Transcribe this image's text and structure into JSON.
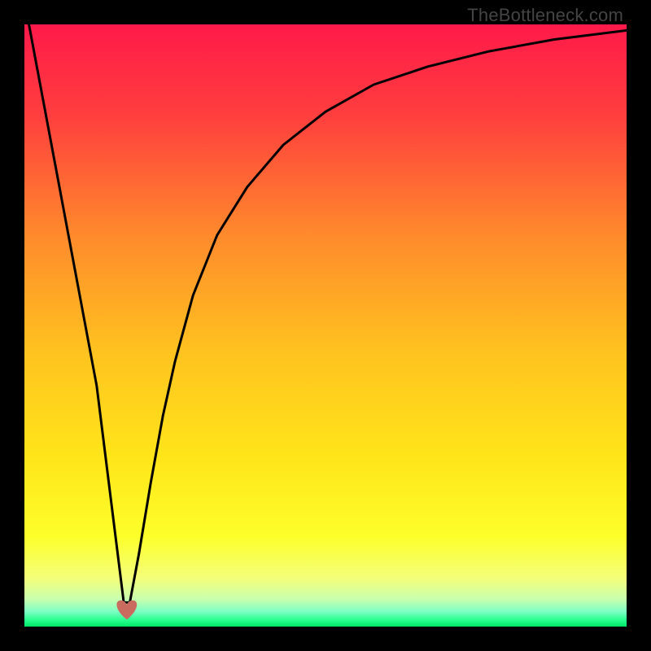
{
  "watermark": "TheBottleneck.com",
  "chart_data": {
    "type": "line",
    "title": "",
    "xlabel": "",
    "ylabel": "",
    "xlim": [
      0,
      100
    ],
    "ylim": [
      0,
      100
    ],
    "grid": false,
    "legend": false,
    "annotations": [],
    "background_gradient": {
      "type": "vertical",
      "stops": [
        {
          "offset": 0.0,
          "color": "#ff1a49"
        },
        {
          "offset": 0.15,
          "color": "#ff3e3e"
        },
        {
          "offset": 0.35,
          "color": "#ff8a2c"
        },
        {
          "offset": 0.55,
          "color": "#ffc41f"
        },
        {
          "offset": 0.72,
          "color": "#ffe51a"
        },
        {
          "offset": 0.85,
          "color": "#fdff2a"
        },
        {
          "offset": 0.92,
          "color": "#f4ff7a"
        },
        {
          "offset": 0.955,
          "color": "#c8ffb0"
        },
        {
          "offset": 0.975,
          "color": "#7dffc4"
        },
        {
          "offset": 0.99,
          "color": "#25ff8c"
        },
        {
          "offset": 1.0,
          "color": "#00e768"
        }
      ]
    },
    "series": [
      {
        "name": "bottleneck-curve",
        "color": "#000000",
        "stroke_width": 3,
        "x": [
          0,
          3,
          6,
          9,
          12,
          14,
          15.5,
          16.5,
          17.5,
          19,
          21,
          23,
          25,
          28,
          32,
          37,
          43,
          50,
          58,
          67,
          77,
          88,
          100
        ],
        "values": [
          104,
          88,
          72,
          56,
          40,
          24,
          12,
          4,
          4,
          12,
          24,
          35,
          44,
          55,
          65,
          73,
          80,
          85.5,
          90,
          93,
          95.5,
          97.5,
          99
        ]
      }
    ],
    "marker": {
      "name": "heart-marker",
      "x": 17,
      "y": 2.2,
      "color": "#c96b5e",
      "size": 28
    }
  }
}
